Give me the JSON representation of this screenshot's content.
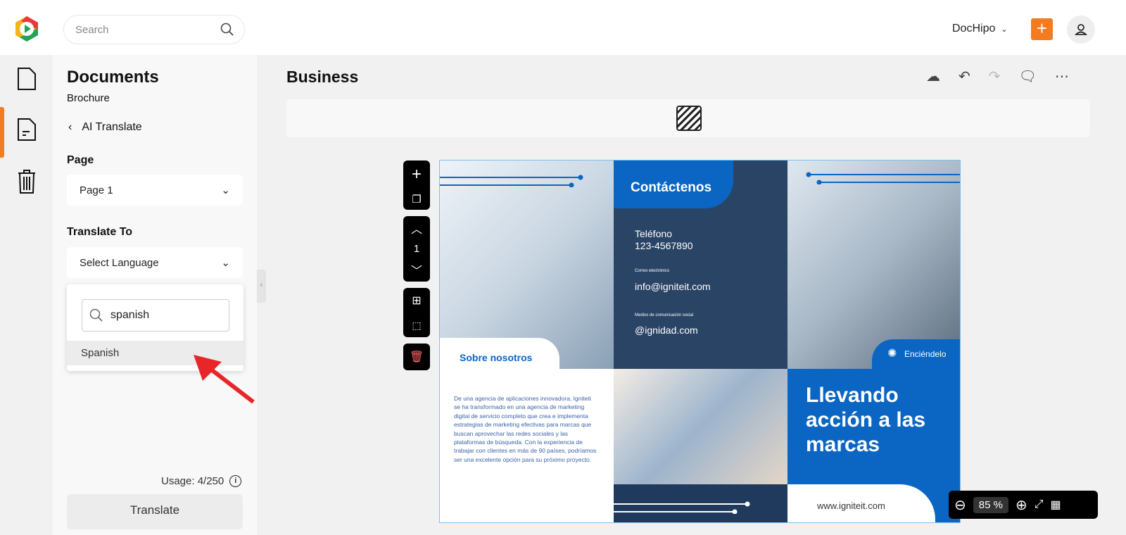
{
  "header": {
    "search_placeholder": "Search",
    "account": "DocHipo"
  },
  "panel": {
    "title": "Documents",
    "subtitle": "Brochure",
    "back_label": "AI Translate",
    "page_label": "Page",
    "page_value": "Page 1",
    "translate_to_label": "Translate To",
    "language_placeholder": "Select Language",
    "language_search_value": "spanish",
    "language_options": [
      "Spanish"
    ],
    "usage": "Usage: 4/250",
    "translate_button": "Translate"
  },
  "main": {
    "title": "Business",
    "page_number": "1",
    "zoom_value": "85",
    "zoom_unit": "%"
  },
  "brochure": {
    "contact_title": "Contáctenos",
    "phone_label": "Teléfono",
    "phone": "123-4567890",
    "email_label": "Correo electrónico",
    "email": "info@igniteit.com",
    "social_label": "Medios de comunicación social",
    "social": "@ignidad.com",
    "about_title": "Sobre nosotros",
    "about_text": "De una agencia de aplicaciones innovadora, Igniteit se ha transformado en una agencia de marketing digital de servicio completo que crea e implementa estrategias de marketing efectivas para marcas que buscan aprovechar las redes sociales y las plataformas de búsqueda. Con la experiencia de trabajar con clientes en más de 90 países, podríamos ser una excelente opción para su próximo proyecto.",
    "brand": "Enciéndelo",
    "headline": "Llevando acción a las marcas",
    "website": "www.igniteit.com"
  },
  "colors": {
    "accent": "#f47b20",
    "brand_blue": "#0a66c2",
    "navy": "#1f3a5c"
  }
}
